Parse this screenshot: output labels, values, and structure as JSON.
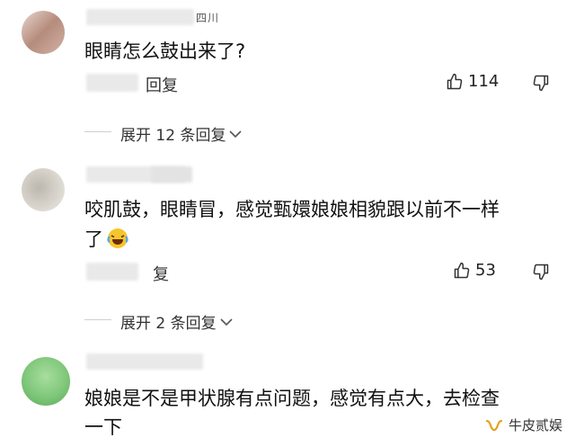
{
  "comments": [
    {
      "username_tail": "四川",
      "text": "眼睛怎么鼓出来了?",
      "reply_label": "回复",
      "likes": "114",
      "expand_label": "展开 12 条回复"
    },
    {
      "username_tail": "",
      "text_line1": "咬肌鼓，眼睛冒，感觉甄嬛娘娘相貌跟以前不一样",
      "text_line2": "了",
      "reply_label": "复",
      "likes": "53",
      "expand_label": "展开 2 条回复"
    },
    {
      "text_line1": "娘娘是不是甲状腺有点问题，感觉有点大，去检查",
      "text_line2": "一下"
    }
  ],
  "watermark": {
    "label": "牛皮贰娱",
    "icon": "wechat-channel-icon"
  },
  "colors": {
    "avatar1": "#b58c7c",
    "avatar2": "#d8d4cc",
    "avatar3": "#7fc77a",
    "laugh_emoji": "#f6c52b"
  }
}
